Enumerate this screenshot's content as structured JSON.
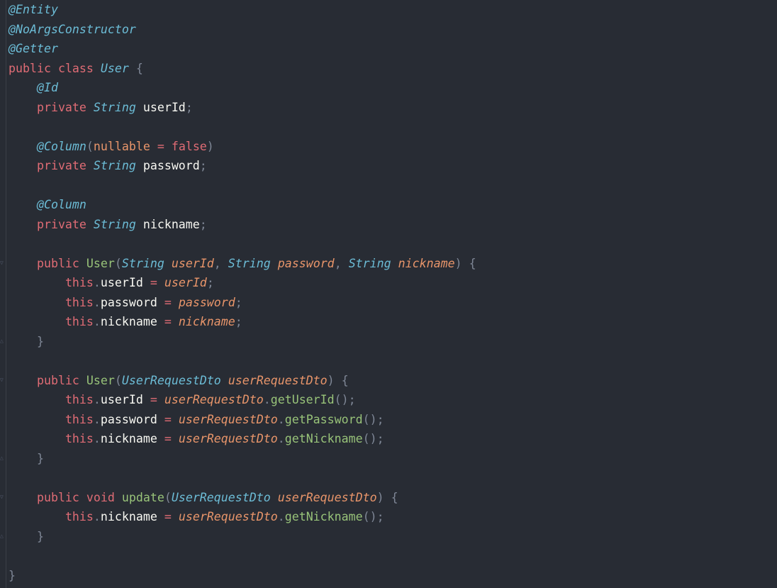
{
  "code": {
    "entity_annotation": "@Entity",
    "noargs_annotation": "@NoArgsConstructor",
    "getter_annotation": "@Getter",
    "public_kw": "public",
    "class_kw": "class",
    "class_name": "User",
    "open_brace": "{",
    "close_brace": "}",
    "id_annotation": "@Id",
    "column_annotation": "@Column",
    "private_kw": "private",
    "this_kw": "this",
    "void_kw": "void",
    "string_type": "String",
    "dto_type": "UserRequestDto",
    "field_userid": "userId",
    "field_password": "password",
    "field_nickname": "nickname",
    "param_userid": "userId",
    "param_password": "password",
    "param_nickname": "nickname",
    "param_dto": "userRequestDto",
    "attr_nullable": "nullable",
    "attr_equals": "=",
    "attr_false": "false",
    "ctor_name": "User",
    "update_method": "update",
    "get_userid": "getUserId",
    "get_password": "getPassword",
    "get_nickname": "getNickname",
    "semicolon": ";",
    "comma": ",",
    "dot": ".",
    "lparen": "(",
    "rparen": ")",
    "call_parens": "()",
    "assign": "="
  },
  "colors": {
    "background": "#282c34",
    "keyword": "#e06c75",
    "annotation": "#6cbcd6",
    "parameter": "#e8956a",
    "method": "#98c379"
  }
}
